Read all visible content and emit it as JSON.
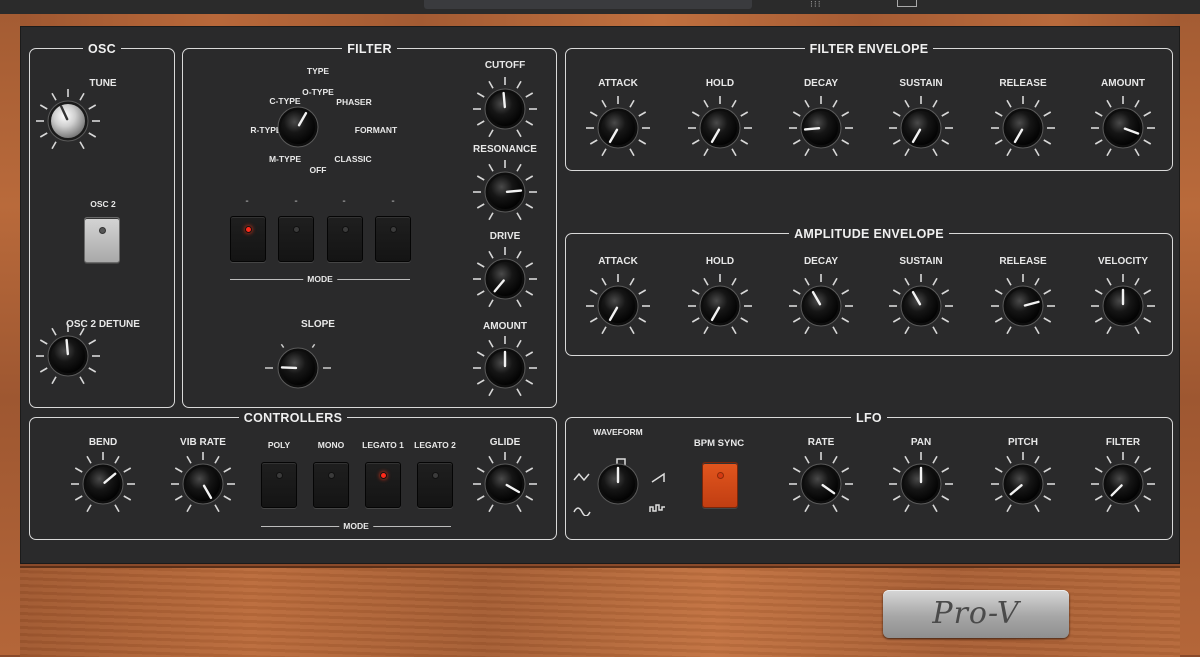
{
  "osc": {
    "title": "OSC",
    "tune_label": "TUNE",
    "osc2_label": "OSC 2",
    "osc2_detune_label": "OSC 2 DETUNE"
  },
  "filter": {
    "title": "FILTER",
    "type_label": "TYPE",
    "types": [
      "C-TYPE",
      "O-TYPE",
      "PHASER",
      "R-TYPE",
      "FORMANT",
      "M-TYPE",
      "OFF",
      "CLASSIC"
    ],
    "cutoff_label": "CUTOFF",
    "resonance_label": "RESONANCE",
    "drive_label": "DRIVE",
    "amount_label": "AMOUNT",
    "slope_label": "SLOPE",
    "mode_label": "MODE",
    "mode_button_labels": [
      "-",
      "-",
      "-",
      "-"
    ]
  },
  "filter_envelope": {
    "title": "FILTER ENVELOPE",
    "labels": [
      "ATTACK",
      "HOLD",
      "DECAY",
      "SUSTAIN",
      "RELEASE",
      "AMOUNT"
    ]
  },
  "amplitude_envelope": {
    "title": "AMPLITUDE ENVELOPE",
    "labels": [
      "ATTACK",
      "HOLD",
      "DECAY",
      "SUSTAIN",
      "RELEASE",
      "VELOCITY"
    ]
  },
  "controllers": {
    "title": "CONTROLLERS",
    "bend_label": "BEND",
    "vib_rate_label": "VIB RATE",
    "mode_buttons": [
      "POLY",
      "MONO",
      "LEGATO 1",
      "LEGATO 2"
    ],
    "mode_label": "MODE",
    "glide_label": "GLIDE"
  },
  "lfo": {
    "title": "LFO",
    "waveform_label": "WAVEFORM",
    "bpm_sync_label": "BPM SYNC",
    "rate_label": "RATE",
    "pan_label": "PAN",
    "pitch_label": "PITCH",
    "filter_label": "FILTER"
  },
  "logo": "Pro-V",
  "colors": {
    "panel": "#2a2a2b",
    "wood": "#b0643a",
    "led_on": "#ff2a1a",
    "bpm_sync_button": "#d24a18",
    "section_border": "#d9d9d9"
  }
}
